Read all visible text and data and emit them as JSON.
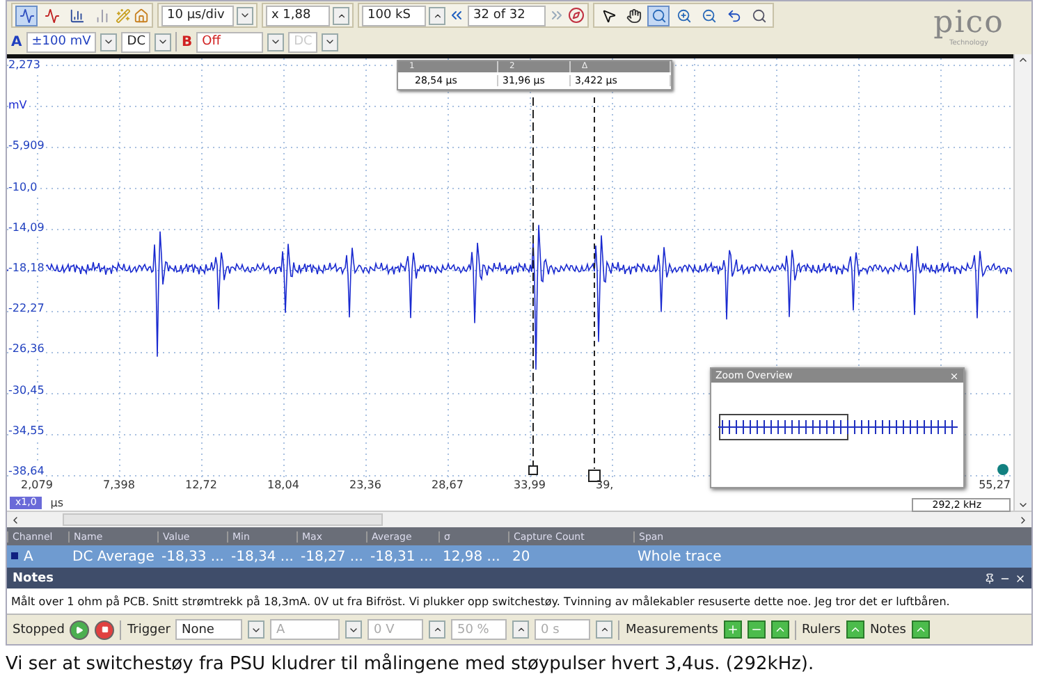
{
  "toolbar": {
    "modes": [
      {
        "kind": "scope",
        "selected": true
      },
      {
        "kind": "persistence",
        "selected": false
      },
      {
        "kind": "spectrum",
        "selected": false
      },
      {
        "kind": "spectrum-persist",
        "selected": false
      }
    ],
    "timebase": "10 µs/div",
    "zoom": "x 1,88",
    "samples": "100 kS",
    "capture": "32 of 32",
    "tools": [
      {
        "kind": "pointer",
        "selected": false
      },
      {
        "kind": "hand",
        "selected": false
      },
      {
        "kind": "zoom-area",
        "selected": true
      },
      {
        "kind": "zoom-in",
        "selected": false
      },
      {
        "kind": "zoom-out",
        "selected": false
      },
      {
        "kind": "undo",
        "selected": false
      },
      {
        "kind": "zoom-fit",
        "selected": false
      }
    ]
  },
  "channels": [
    {
      "name": "A",
      "range": "±100 mV",
      "coupling": "DC",
      "enabled": true,
      "color": "#1f3fbf"
    },
    {
      "name": "B",
      "range": "Off",
      "coupling": "DC",
      "enabled": false,
      "color": "#d02020"
    }
  ],
  "logo": {
    "name": "pico",
    "tagline": "Technology"
  },
  "scope": {
    "y_labels": [
      "2,273",
      "-5,909",
      "-10,0",
      "-14,09",
      "-18,18",
      "-22,27",
      "-26,36",
      "-30,45",
      "-34,55",
      "-38,64"
    ],
    "y_unit": "mV",
    "x_labels": [
      "2,079",
      "7,398",
      "12,72",
      "18,04",
      "23,36",
      "28,67",
      "33,99",
      "39,",
      "55,27"
    ],
    "x_unit": "µs",
    "zoom_factor": "x1,0",
    "rulers": {
      "headers": [
        "1",
        "2",
        "Δ"
      ],
      "values": [
        "28,54 µs",
        "31,96 µs",
        "3,422 µs"
      ]
    },
    "frequency": "292,2 kHz",
    "zoom_overview": {
      "title": "Zoom Overview"
    }
  },
  "measurements": {
    "columns": [
      "Channel",
      "Name",
      "Value",
      "Min",
      "Max",
      "Average",
      "σ",
      "Capture Count",
      "Span"
    ],
    "rows": [
      {
        "selected": true,
        "cells": [
          "A",
          "DC Average",
          "-18,33 ...",
          "-18,34 ...",
          "-18,27 ...",
          "-18,31 ...",
          "12,98 ...",
          "20",
          "Whole trace"
        ]
      }
    ]
  },
  "notes": {
    "title": "Notes",
    "text": "Målt over 1 ohm på PCB. Snitt strømtrekk på 18,3mA. 0V ut fra Bifröst. Vi plukker opp switchestøy. Tvinning av målekabler resuserte dette noe. Jeg tror det er luftbåren."
  },
  "status_bar": {
    "state": "Stopped",
    "trigger_label": "Trigger",
    "trigger_mode": "None",
    "trigger_channel": "A",
    "threshold": "0 V",
    "pre_trigger": "50 %",
    "delay": "0 s",
    "measurements": "Measurements",
    "rulers": "Rulers",
    "notes": "Notes"
  },
  "caption": "Vi ser at switchestøy fra PSU kludrer til målingene med støypulser hvert 3,4us. (292kHz)."
}
